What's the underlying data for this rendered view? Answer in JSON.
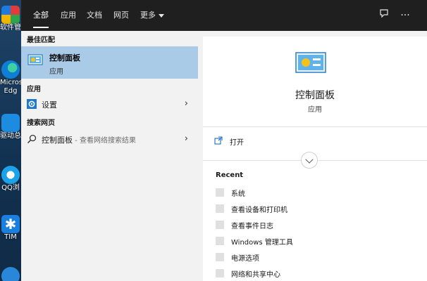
{
  "desktop": {
    "icons": [
      {
        "label": "软件管"
      },
      {
        "label": "Micros"
      },
      {
        "label": "Edg"
      },
      {
        "label": "驱动总"
      },
      {
        "label": "QQ浏"
      },
      {
        "label": "TIM"
      }
    ]
  },
  "tabs": [
    {
      "label": "全部",
      "active": true
    },
    {
      "label": "应用"
    },
    {
      "label": "文档"
    },
    {
      "label": "网页"
    },
    {
      "label": "更多"
    }
  ],
  "toolbar": {
    "feedback_icon": "feedback-icon",
    "more_icon": "ellipsis-icon",
    "more_glyph": "···"
  },
  "left": {
    "best_match_header": "最佳匹配",
    "best_match": {
      "title": "控制面板",
      "subtitle": "应用"
    },
    "apps_header": "应用",
    "apps": [
      {
        "label": "设置",
        "chevron": "›"
      }
    ],
    "web_header": "搜索网页",
    "web": [
      {
        "label": "控制面板",
        "suffix": " - 查看网络搜索结果",
        "chevron": "›"
      }
    ]
  },
  "right": {
    "title": "控制面板",
    "subtitle": "应用",
    "open_label": "打开",
    "recent_header": "Recent",
    "recent": [
      "系统",
      "查看设备和打印机",
      "查看事件日志",
      "Windows 管理工具",
      "电源选项",
      "网络和共享中心"
    ]
  },
  "colors": {
    "selected": "#a9cbe8",
    "topbar": "#1f1f1f",
    "accent": "#0078d4"
  }
}
